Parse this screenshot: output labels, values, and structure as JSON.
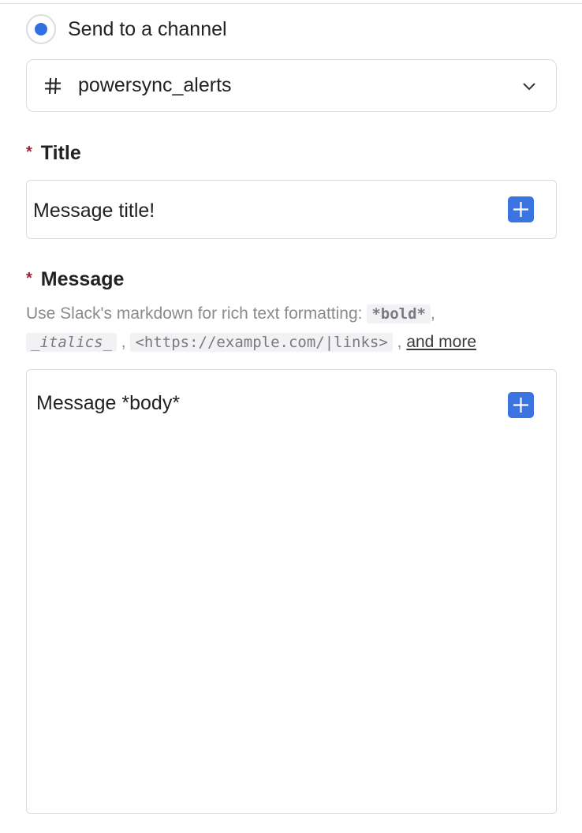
{
  "delivery": {
    "option_label": "Send to a channel",
    "selected": true
  },
  "channel_select": {
    "value": "powersync_alerts",
    "icon": "hash-icon"
  },
  "title_field": {
    "required_mark": "*",
    "label": "Title",
    "value": "Message title!",
    "insert_icon": "plus-icon"
  },
  "message_field": {
    "required_mark": "*",
    "label": "Message",
    "help_prefix": "Use Slack's markdown for rich text formatting:",
    "help_bold": "*bold*",
    "help_italics": "_italics_",
    "help_link_example": "<https://example.com/|links>",
    "help_more_link": "and more",
    "sep1": ",",
    "sep2": ",",
    "sep3": ",",
    "value": "Message *body*",
    "insert_icon": "plus-icon"
  },
  "colors": {
    "accent": "#2f6fe0",
    "button": "#3b74e0",
    "required": "#a0223a"
  }
}
